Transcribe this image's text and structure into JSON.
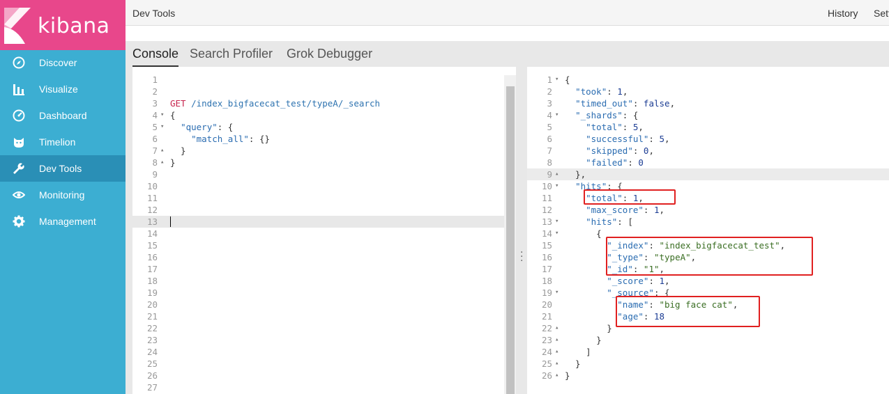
{
  "app": {
    "brand": "kibana"
  },
  "sidebar": {
    "items": [
      {
        "label": "Discover",
        "icon": "compass-icon",
        "active": false
      },
      {
        "label": "Visualize",
        "icon": "bar-chart-icon",
        "active": false
      },
      {
        "label": "Dashboard",
        "icon": "dashboard-gauge-icon",
        "active": false
      },
      {
        "label": "Timelion",
        "icon": "timelion-cat-icon",
        "active": false
      },
      {
        "label": "Dev Tools",
        "icon": "wrench-icon",
        "active": true
      },
      {
        "label": "Monitoring",
        "icon": "eye-icon",
        "active": false
      },
      {
        "label": "Management",
        "icon": "gear-icon",
        "active": false
      }
    ]
  },
  "topbar": {
    "title": "Dev Tools",
    "history": "History",
    "settings": "Settings"
  },
  "tabs": [
    {
      "label": "Console",
      "active": true
    },
    {
      "label": "Search Profiler",
      "active": false
    },
    {
      "label": "Grok Debugger",
      "active": false
    }
  ],
  "input_editor": {
    "lines": [
      {
        "n": "1",
        "fold": "",
        "tokens": []
      },
      {
        "n": "2",
        "fold": "",
        "tokens": []
      },
      {
        "n": "3",
        "fold": "",
        "tokens": [
          [
            "method",
            "GET"
          ],
          [
            "punc",
            " "
          ],
          [
            "url",
            "/index_bigfacecat_test/typeA/_search"
          ]
        ]
      },
      {
        "n": "4",
        "fold": "▾",
        "tokens": [
          [
            "punc",
            "{"
          ]
        ]
      },
      {
        "n": "5",
        "fold": "▾",
        "tokens": [
          [
            "punc",
            "  "
          ],
          [
            "key",
            "\"query\""
          ],
          [
            "punc",
            ": {"
          ]
        ]
      },
      {
        "n": "6",
        "fold": "",
        "tokens": [
          [
            "punc",
            "    "
          ],
          [
            "key",
            "\"match_all\""
          ],
          [
            "punc",
            ": {}"
          ]
        ]
      },
      {
        "n": "7",
        "fold": "▴",
        "tokens": [
          [
            "punc",
            "  }"
          ]
        ]
      },
      {
        "n": "8",
        "fold": "▴",
        "tokens": [
          [
            "punc",
            "}"
          ]
        ]
      },
      {
        "n": "9",
        "fold": "",
        "tokens": []
      },
      {
        "n": "10",
        "fold": "",
        "tokens": []
      },
      {
        "n": "11",
        "fold": "",
        "tokens": []
      },
      {
        "n": "12",
        "fold": "",
        "tokens": []
      },
      {
        "n": "13",
        "fold": "",
        "tokens": []
      },
      {
        "n": "14",
        "fold": "",
        "tokens": []
      },
      {
        "n": "15",
        "fold": "",
        "tokens": []
      },
      {
        "n": "16",
        "fold": "",
        "tokens": []
      },
      {
        "n": "17",
        "fold": "",
        "tokens": []
      },
      {
        "n": "18",
        "fold": "",
        "tokens": []
      },
      {
        "n": "19",
        "fold": "",
        "tokens": []
      },
      {
        "n": "20",
        "fold": "",
        "tokens": []
      },
      {
        "n": "21",
        "fold": "",
        "tokens": []
      },
      {
        "n": "22",
        "fold": "",
        "tokens": []
      },
      {
        "n": "23",
        "fold": "",
        "tokens": []
      },
      {
        "n": "24",
        "fold": "",
        "tokens": []
      },
      {
        "n": "25",
        "fold": "",
        "tokens": []
      },
      {
        "n": "26",
        "fold": "",
        "tokens": []
      },
      {
        "n": "27",
        "fold": "",
        "tokens": []
      }
    ]
  },
  "output_editor": {
    "lines": [
      {
        "n": "1",
        "fold": "▾",
        "tokens": [
          [
            "punc",
            "{"
          ]
        ]
      },
      {
        "n": "2",
        "fold": "",
        "tokens": [
          [
            "punc",
            "  "
          ],
          [
            "key",
            "\"took\""
          ],
          [
            "punc",
            ": "
          ],
          [
            "num",
            "1"
          ],
          [
            "punc",
            ","
          ]
        ]
      },
      {
        "n": "3",
        "fold": "",
        "tokens": [
          [
            "punc",
            "  "
          ],
          [
            "key",
            "\"timed_out\""
          ],
          [
            "punc",
            ": "
          ],
          [
            "bool",
            "false"
          ],
          [
            "punc",
            ","
          ]
        ]
      },
      {
        "n": "4",
        "fold": "▾",
        "tokens": [
          [
            "punc",
            "  "
          ],
          [
            "key",
            "\"_shards\""
          ],
          [
            "punc",
            ": {"
          ]
        ]
      },
      {
        "n": "5",
        "fold": "",
        "tokens": [
          [
            "punc",
            "    "
          ],
          [
            "key",
            "\"total\""
          ],
          [
            "punc",
            ": "
          ],
          [
            "num",
            "5"
          ],
          [
            "punc",
            ","
          ]
        ]
      },
      {
        "n": "6",
        "fold": "",
        "tokens": [
          [
            "punc",
            "    "
          ],
          [
            "key",
            "\"successful\""
          ],
          [
            "punc",
            ": "
          ],
          [
            "num",
            "5"
          ],
          [
            "punc",
            ","
          ]
        ]
      },
      {
        "n": "7",
        "fold": "",
        "tokens": [
          [
            "punc",
            "    "
          ],
          [
            "key",
            "\"skipped\""
          ],
          [
            "punc",
            ": "
          ],
          [
            "num",
            "0"
          ],
          [
            "punc",
            ","
          ]
        ]
      },
      {
        "n": "8",
        "fold": "",
        "tokens": [
          [
            "punc",
            "    "
          ],
          [
            "key",
            "\"failed\""
          ],
          [
            "punc",
            ": "
          ],
          [
            "num",
            "0"
          ]
        ]
      },
      {
        "n": "9",
        "fold": "▴",
        "tokens": [
          [
            "punc",
            "  },"
          ]
        ]
      },
      {
        "n": "10",
        "fold": "▾",
        "tokens": [
          [
            "punc",
            "  "
          ],
          [
            "key",
            "\"hits\""
          ],
          [
            "punc",
            ": {"
          ]
        ]
      },
      {
        "n": "11",
        "fold": "",
        "tokens": [
          [
            "punc",
            "    "
          ],
          [
            "key",
            "\"total\""
          ],
          [
            "punc",
            ": "
          ],
          [
            "num",
            "1"
          ],
          [
            "punc",
            ","
          ]
        ]
      },
      {
        "n": "12",
        "fold": "",
        "tokens": [
          [
            "punc",
            "    "
          ],
          [
            "key",
            "\"max_score\""
          ],
          [
            "punc",
            ": "
          ],
          [
            "num",
            "1"
          ],
          [
            "punc",
            ","
          ]
        ]
      },
      {
        "n": "13",
        "fold": "▾",
        "tokens": [
          [
            "punc",
            "    "
          ],
          [
            "key",
            "\"hits\""
          ],
          [
            "punc",
            ": ["
          ]
        ]
      },
      {
        "n": "14",
        "fold": "▾",
        "tokens": [
          [
            "punc",
            "      {"
          ]
        ]
      },
      {
        "n": "15",
        "fold": "",
        "tokens": [
          [
            "punc",
            "        "
          ],
          [
            "key",
            "\"_index\""
          ],
          [
            "punc",
            ": "
          ],
          [
            "str",
            "\"index_bigfacecat_test\""
          ],
          [
            "punc",
            ","
          ]
        ]
      },
      {
        "n": "16",
        "fold": "",
        "tokens": [
          [
            "punc",
            "        "
          ],
          [
            "key",
            "\"_type\""
          ],
          [
            "punc",
            ": "
          ],
          [
            "str",
            "\"typeA\""
          ],
          [
            "punc",
            ","
          ]
        ]
      },
      {
        "n": "17",
        "fold": "",
        "tokens": [
          [
            "punc",
            "        "
          ],
          [
            "key",
            "\"_id\""
          ],
          [
            "punc",
            ": "
          ],
          [
            "str",
            "\"1\""
          ],
          [
            "punc",
            ","
          ]
        ]
      },
      {
        "n": "18",
        "fold": "",
        "tokens": [
          [
            "punc",
            "        "
          ],
          [
            "key",
            "\"_score\""
          ],
          [
            "punc",
            ": "
          ],
          [
            "num",
            "1"
          ],
          [
            "punc",
            ","
          ]
        ]
      },
      {
        "n": "19",
        "fold": "▾",
        "tokens": [
          [
            "punc",
            "        "
          ],
          [
            "key",
            "\"_source\""
          ],
          [
            "punc",
            ": {"
          ]
        ]
      },
      {
        "n": "20",
        "fold": "",
        "tokens": [
          [
            "punc",
            "          "
          ],
          [
            "key",
            "\"name\""
          ],
          [
            "punc",
            ": "
          ],
          [
            "str",
            "\"big face cat\""
          ],
          [
            "punc",
            ","
          ]
        ]
      },
      {
        "n": "21",
        "fold": "",
        "tokens": [
          [
            "punc",
            "          "
          ],
          [
            "key",
            "\"age\""
          ],
          [
            "punc",
            ": "
          ],
          [
            "num",
            "18"
          ]
        ]
      },
      {
        "n": "22",
        "fold": "▴",
        "tokens": [
          [
            "punc",
            "        }"
          ]
        ]
      },
      {
        "n": "23",
        "fold": "▴",
        "tokens": [
          [
            "punc",
            "      }"
          ]
        ]
      },
      {
        "n": "24",
        "fold": "▴",
        "tokens": [
          [
            "punc",
            "    ]"
          ]
        ]
      },
      {
        "n": "25",
        "fold": "▴",
        "tokens": [
          [
            "punc",
            "  }"
          ]
        ]
      },
      {
        "n": "26",
        "fold": "▴",
        "tokens": [
          [
            "punc",
            "}"
          ]
        ]
      }
    ]
  },
  "colors": {
    "sidebar_bg": "#3caed2",
    "logo_bg": "#e8478b",
    "active_nav_bg": "#2a8fb6",
    "annotation_red": "#e02020"
  }
}
